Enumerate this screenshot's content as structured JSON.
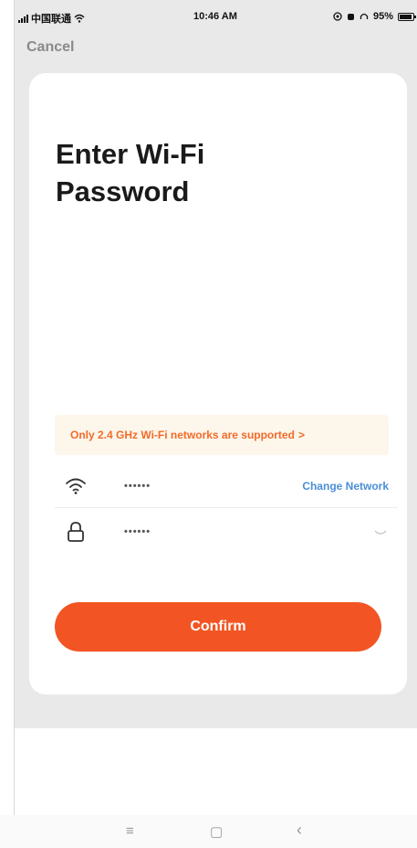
{
  "status_bar": {
    "carrier": "中国联通",
    "time": "10:46 AM",
    "battery": "95%"
  },
  "header": {
    "cancel_label": "Cancel"
  },
  "card": {
    "title": "Enter Wi-Fi Password",
    "notice": "Only 2.4 GHz Wi-Fi networks are supported",
    "notice_chevron": ">",
    "wifi_name": "••••••",
    "change_network_label": "Change Network",
    "password_value": "••••••",
    "confirm_label": "Confirm"
  },
  "nav_bar": {
    "menu_glyph": "≡",
    "home_glyph": "▢",
    "back_glyph": "‹"
  },
  "colors": {
    "accent": "#f25523",
    "notice_text": "#f26b2a",
    "link": "#4a8fd6"
  }
}
